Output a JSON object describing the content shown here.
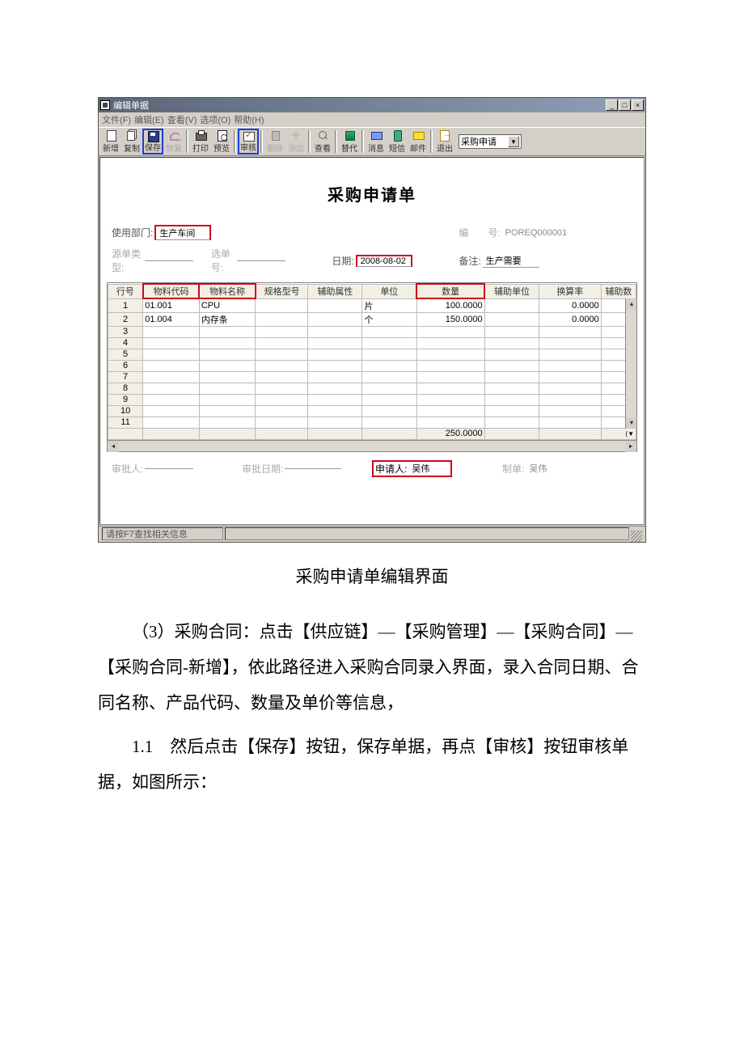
{
  "window": {
    "title": "编辑单据",
    "min_label": "_",
    "max_label": "□",
    "close_label": "×"
  },
  "menubar": {
    "file": "文件(F)",
    "edit": "编辑(E)",
    "view": "查看(V)",
    "options": "选项(O)",
    "help": "帮助(H)"
  },
  "toolbar": {
    "new": "新增",
    "copy": "复制",
    "save": "保存",
    "restore": "恢复",
    "print": "打印",
    "preview": "预览",
    "audit": "审核",
    "delete": "删除",
    "add": "添加",
    "find": "查看",
    "replace": "替代",
    "message": "消息",
    "sms": "短信",
    "mail": "邮件",
    "exit": "退出",
    "combo_value": "采购申请",
    "combo_arrow": "▼"
  },
  "form": {
    "title": "采购申请单",
    "dept_label": "使用部门:",
    "dept_value": "生产车间",
    "code_label": "编　　号:",
    "code_value": "POREQ000001",
    "source_type_label": "源单类型:",
    "order_no_label": "选单号:",
    "date_label": "日期:",
    "date_value": "2008-08-02",
    "remark_label": "备注:",
    "remark_value": "生产需要"
  },
  "grid": {
    "headers": {
      "row": "行号",
      "code": "物料代码",
      "name": "物料名称",
      "spec": "规格型号",
      "aux_attr": "辅助属性",
      "unit": "单位",
      "qty": "数量",
      "aux_unit": "辅助单位",
      "rate": "换算率",
      "aux_qty": "辅助数"
    },
    "rows": [
      {
        "n": "1",
        "code": "01.001",
        "name": "CPU",
        "spec": "",
        "aux_attr": "",
        "unit": "片",
        "qty": "100.0000",
        "aux_unit": "",
        "rate": "0.0000",
        "aux_qty": ""
      },
      {
        "n": "2",
        "code": "01.004",
        "name": "内存条",
        "spec": "",
        "aux_attr": "",
        "unit": "个",
        "qty": "150.0000",
        "aux_unit": "",
        "rate": "0.0000",
        "aux_qty": ""
      }
    ],
    "empty_rows": [
      "3",
      "4",
      "5",
      "6",
      "7",
      "8",
      "9",
      "10",
      "11"
    ],
    "total_qty": "250.0000"
  },
  "footer": {
    "approver_label": "审批人:",
    "approver_value": "",
    "approve_date_label": "审批日期:",
    "approve_date_value": "",
    "applicant_label": "申请人:",
    "applicant_value": "吴伟",
    "maker_label": "制单:",
    "maker_value": "吴伟"
  },
  "statusbar": {
    "hint": "请按F7查找相关信息"
  },
  "doc": {
    "caption": "采购申请单编辑界面",
    "p1": "（3）采购合同：点击【供应链】—【采购管理】—【采购合同】—【采购合同-新增】，依此路径进入采购合同录入界面，录入合同日期、合同名称、产品代码、数量及单价等信息，",
    "p2": "1.1　然后点击【保存】按钮，保存单据，再点【审核】按钮审核单据，如图所示："
  }
}
